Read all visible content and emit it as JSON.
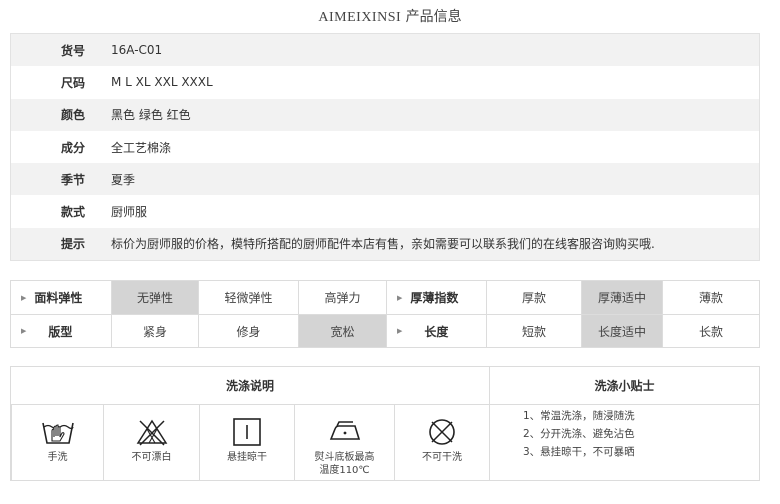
{
  "title": {
    "brand": "AIMEIXINSI",
    "suffix": "产品信息"
  },
  "info_rows": [
    {
      "label": "货号",
      "value": "16A-C01"
    },
    {
      "label": "尺码",
      "value": "M L XL XXL XXXL"
    },
    {
      "label": "颜色",
      "value": "黑色 绿色 红色"
    },
    {
      "label": "成分",
      "value": "全工艺棉涤"
    },
    {
      "label": "季节",
      "value": "夏季"
    },
    {
      "label": "款式",
      "value": "厨师服"
    },
    {
      "label": "提示",
      "value": "标价为厨师服的价格，模特所搭配的厨师配件本店有售，亲如需要可以联系我们的在线客服咨询购买哦."
    }
  ],
  "attributes": {
    "row1": {
      "elastic_label": "面料弹性",
      "elastic_options": [
        "无弹性",
        "轻微弹性",
        "高弹力"
      ],
      "elastic_selected": "无弹性",
      "thickness_label": "厚薄指数",
      "thickness_options": [
        "厚款",
        "厚薄适中",
        "薄款"
      ],
      "thickness_selected": "厚薄适中"
    },
    "row2": {
      "fit_label": "版型",
      "fit_options": [
        "紧身",
        "修身",
        "宽松"
      ],
      "fit_selected": "宽松",
      "length_label": "长度",
      "length_options": [
        "短款",
        "长度适中",
        "长款"
      ],
      "length_selected": "长度适中"
    }
  },
  "wash": {
    "header": "洗涤说明",
    "tips_header": "洗涤小贴士",
    "symbols": [
      {
        "icon": "hand-wash-icon",
        "caption": "手洗"
      },
      {
        "icon": "no-bleach-icon",
        "caption": "不可漂白"
      },
      {
        "icon": "hang-dry-icon",
        "caption": "悬挂晾干"
      },
      {
        "icon": "iron-icon",
        "caption_line1": "熨斗底板最高",
        "caption_line2": "温度110℃"
      },
      {
        "icon": "no-dry-clean-icon",
        "caption": "不可干洗"
      }
    ],
    "tips": [
      "1、常温洗涤，随浸随洗",
      "2、分开洗涤、避免沾色",
      "3、悬挂晾干，不可暴晒"
    ]
  }
}
